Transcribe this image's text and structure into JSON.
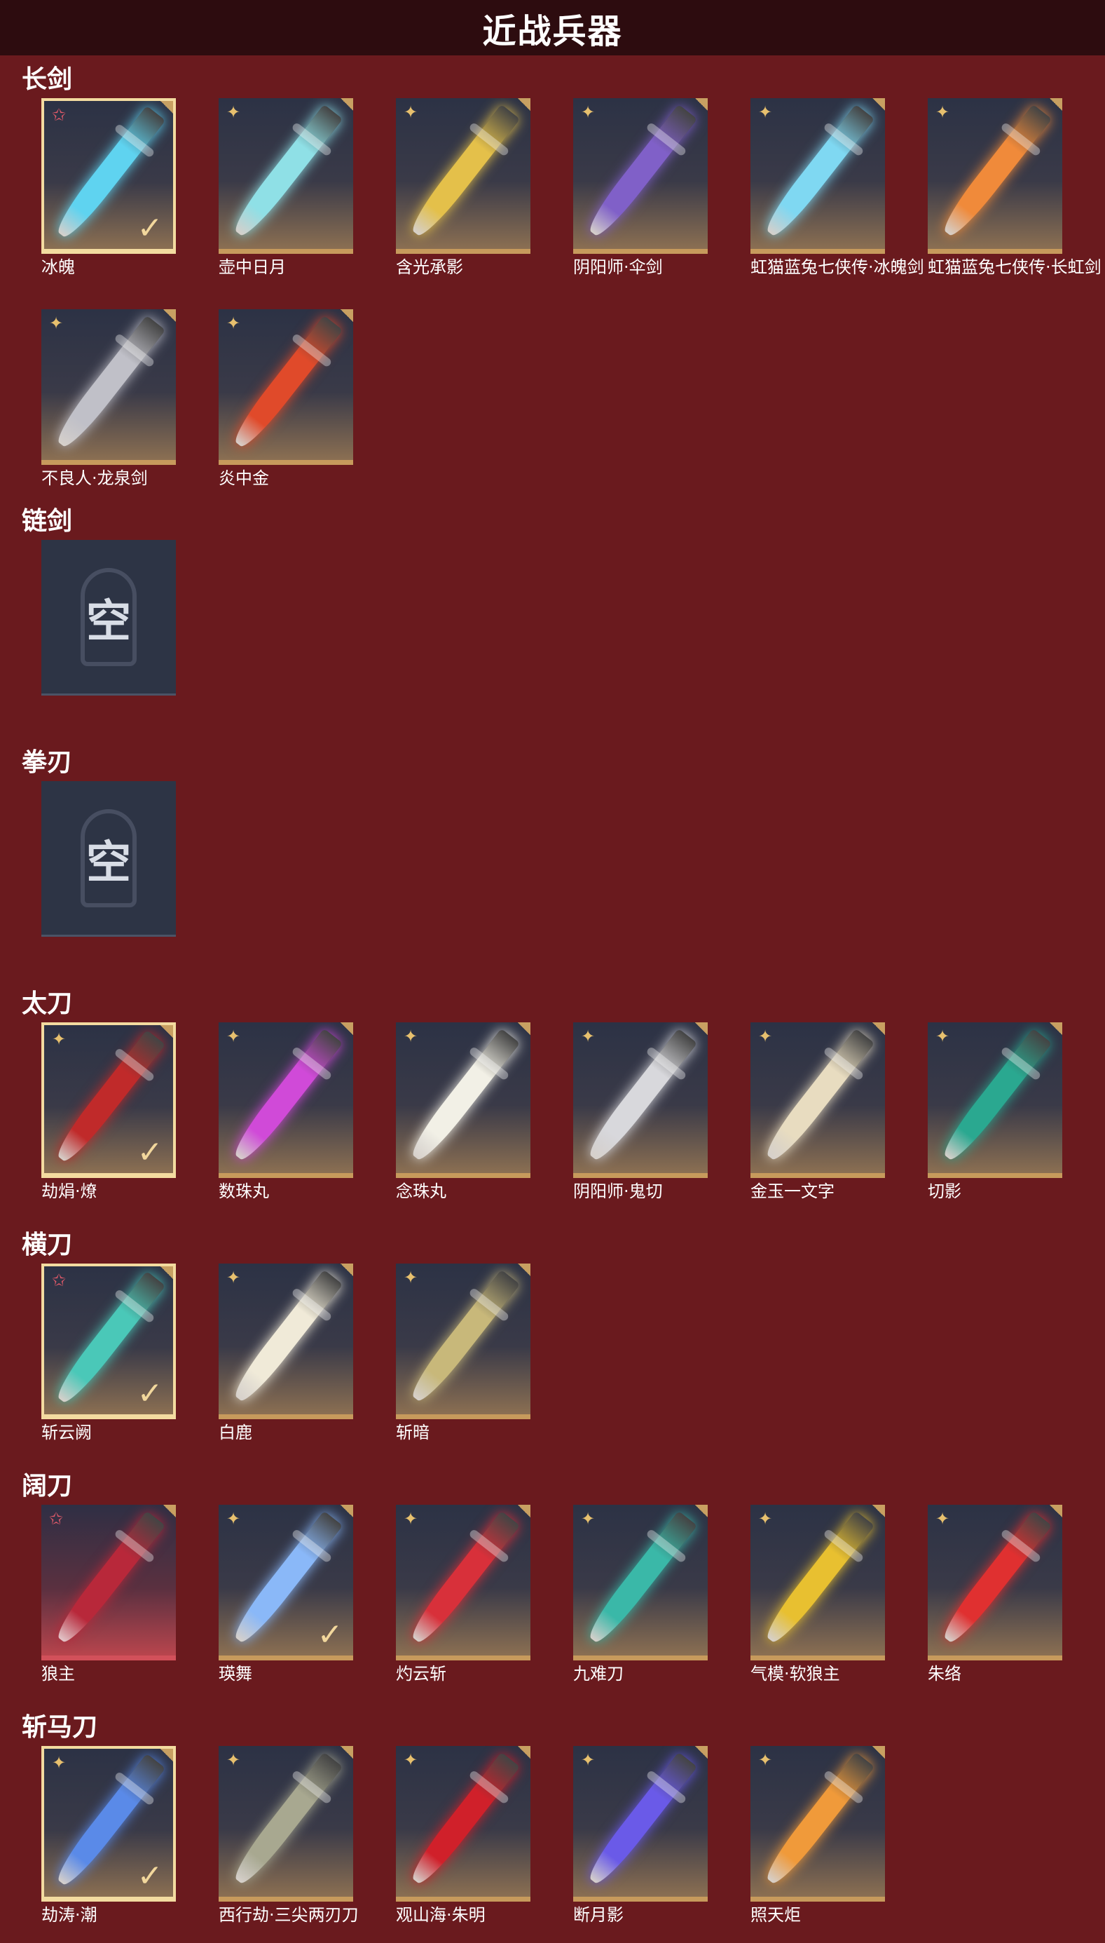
{
  "title": "近战兵器",
  "icons": {
    "rank_gold": "four-point-star-icon",
    "rank_red": "red-star-icon",
    "check": "check-icon",
    "empty": "empty-slot-emblem"
  },
  "colors": {
    "background": "#6a1a1e",
    "titlebar": "#2d0c0f",
    "gold_border": "#c79a5c",
    "selected_border": "#f3dba0",
    "red_rarity": "#d2505a"
  },
  "sections": [
    {
      "label": "长剑",
      "items": [
        {
          "name": "冰魄",
          "selected": true,
          "equipped": true,
          "rank": "red",
          "weapon_color": "#5fd3f0"
        },
        {
          "name": "壶中日月",
          "selected": false,
          "equipped": false,
          "rank": "gold",
          "weapon_color": "#8fe0e6"
        },
        {
          "name": "含光承影",
          "selected": false,
          "equipped": false,
          "rank": "gold",
          "weapon_color": "#e4c04a"
        },
        {
          "name": "阴阳师·伞剑",
          "selected": false,
          "equipped": false,
          "rank": "gold",
          "weapon_color": "#8060c8"
        },
        {
          "name": "虹猫蓝兔七侠传·冰魄剑",
          "selected": false,
          "equipped": false,
          "rank": "gold",
          "weapon_color": "#7fd8f2"
        },
        {
          "name": "虹猫蓝兔七侠传·长虹剑",
          "selected": false,
          "equipped": false,
          "rank": "gold",
          "weapon_color": "#f08a3a"
        },
        {
          "name": "不良人·龙泉剑",
          "selected": false,
          "equipped": false,
          "rank": "gold",
          "weapon_color": "#c0c0c8"
        },
        {
          "name": "炎中金",
          "selected": false,
          "equipped": false,
          "rank": "gold",
          "weapon_color": "#e04a2a"
        }
      ]
    },
    {
      "label": "链剑",
      "items": [
        {
          "empty": true,
          "empty_text": "空"
        }
      ]
    },
    {
      "label": "拳刃",
      "items": [
        {
          "empty": true,
          "empty_text": "空"
        }
      ]
    },
    {
      "label": "太刀",
      "items": [
        {
          "name": "劫焆·燎",
          "selected": true,
          "equipped": true,
          "rank": "gold",
          "weapon_color": "#c02a2a"
        },
        {
          "name": "数珠丸",
          "selected": false,
          "equipped": false,
          "rank": "gold",
          "weapon_color": "#d04ad8"
        },
        {
          "name": "念珠丸",
          "selected": false,
          "equipped": false,
          "rank": "gold",
          "weapon_color": "#f2f0e6"
        },
        {
          "name": "阴阳师·鬼切",
          "selected": false,
          "equipped": false,
          "rank": "gold",
          "weapon_color": "#d8d8dc"
        },
        {
          "name": "金玉一文字",
          "selected": false,
          "equipped": false,
          "rank": "gold",
          "weapon_color": "#e8dcc0"
        },
        {
          "name": "切影",
          "selected": false,
          "equipped": false,
          "rank": "gold",
          "weapon_color": "#2aa890"
        }
      ]
    },
    {
      "label": "横刀",
      "items": [
        {
          "name": "斩云阙",
          "selected": true,
          "equipped": true,
          "rank": "red",
          "weapon_color": "#4ac8b8"
        },
        {
          "name": "白鹿",
          "selected": false,
          "equipped": false,
          "rank": "gold",
          "weapon_color": "#f0ead8"
        },
        {
          "name": "斩暗",
          "selected": false,
          "equipped": false,
          "rank": "gold",
          "weapon_color": "#c8b87a"
        }
      ]
    },
    {
      "label": "阔刀",
      "items": [
        {
          "name": "狼主",
          "selected": false,
          "equipped": false,
          "rank": "red",
          "red_card": true,
          "weapon_color": "#b8283a"
        },
        {
          "name": "瑛舞",
          "selected": false,
          "equipped": true,
          "rank": "gold",
          "weapon_color": "#8ab8f8"
        },
        {
          "name": "灼云斩",
          "selected": false,
          "equipped": false,
          "rank": "gold",
          "weapon_color": "#d8303a"
        },
        {
          "name": "九难刀",
          "selected": false,
          "equipped": false,
          "rank": "gold",
          "weapon_color": "#3ab8a8"
        },
        {
          "name": "气模·软狼主",
          "selected": false,
          "equipped": false,
          "rank": "gold",
          "weapon_color": "#e8c030"
        },
        {
          "name": "朱络",
          "selected": false,
          "equipped": false,
          "rank": "gold",
          "weapon_color": "#e03030"
        }
      ]
    },
    {
      "label": "斩马刀",
      "items": [
        {
          "name": "劫涛·潮",
          "selected": true,
          "equipped": true,
          "rank": "gold",
          "weapon_color": "#5a8ae8"
        },
        {
          "name": "西行劫·三尖两刃刀",
          "selected": false,
          "equipped": false,
          "rank": "gold",
          "weapon_color": "#a8a890"
        },
        {
          "name": "观山海·朱明",
          "selected": false,
          "equipped": false,
          "rank": "gold",
          "weapon_color": "#d0202a"
        },
        {
          "name": "断月影",
          "selected": false,
          "equipped": false,
          "rank": "gold",
          "weapon_color": "#6a5ae8"
        },
        {
          "name": "照天炬",
          "selected": false,
          "equipped": false,
          "rank": "gold",
          "weapon_color": "#f09a3a"
        }
      ]
    }
  ]
}
